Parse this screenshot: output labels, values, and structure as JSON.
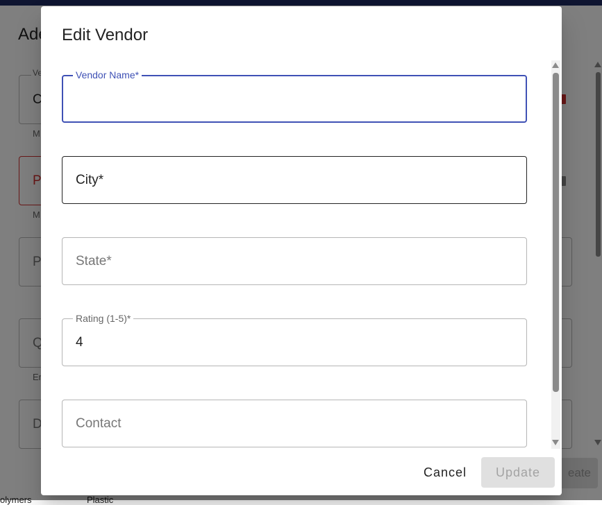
{
  "background": {
    "title_fragment": "Ade",
    "field_labels": [
      "Ve",
      "",
      "",
      "",
      ""
    ],
    "field_letters": [
      "C",
      "P",
      "P",
      "Q",
      "D"
    ],
    "helper_texts": [
      "M",
      "M",
      "",
      "Er",
      ""
    ],
    "create_button_fragment": "eate",
    "bottom_texts": [
      "olymers",
      "Plastic"
    ]
  },
  "dialog": {
    "title": "Edit Vendor",
    "fields": {
      "vendor_name": {
        "label": "Vendor Name*",
        "value": ""
      },
      "city": {
        "placeholder": "City*"
      },
      "state": {
        "placeholder": "State*"
      },
      "rating": {
        "label": "Rating (1-5)*",
        "value": "4"
      },
      "contact": {
        "placeholder": "Contact"
      }
    },
    "actions": {
      "cancel_label": "Cancel",
      "update_label": "Update"
    }
  },
  "colors": {
    "focus_accent": "#3f51b5",
    "error": "#d32f2f",
    "top_bar": "#1f2a63",
    "disabled_button": "#e0e0e0"
  }
}
